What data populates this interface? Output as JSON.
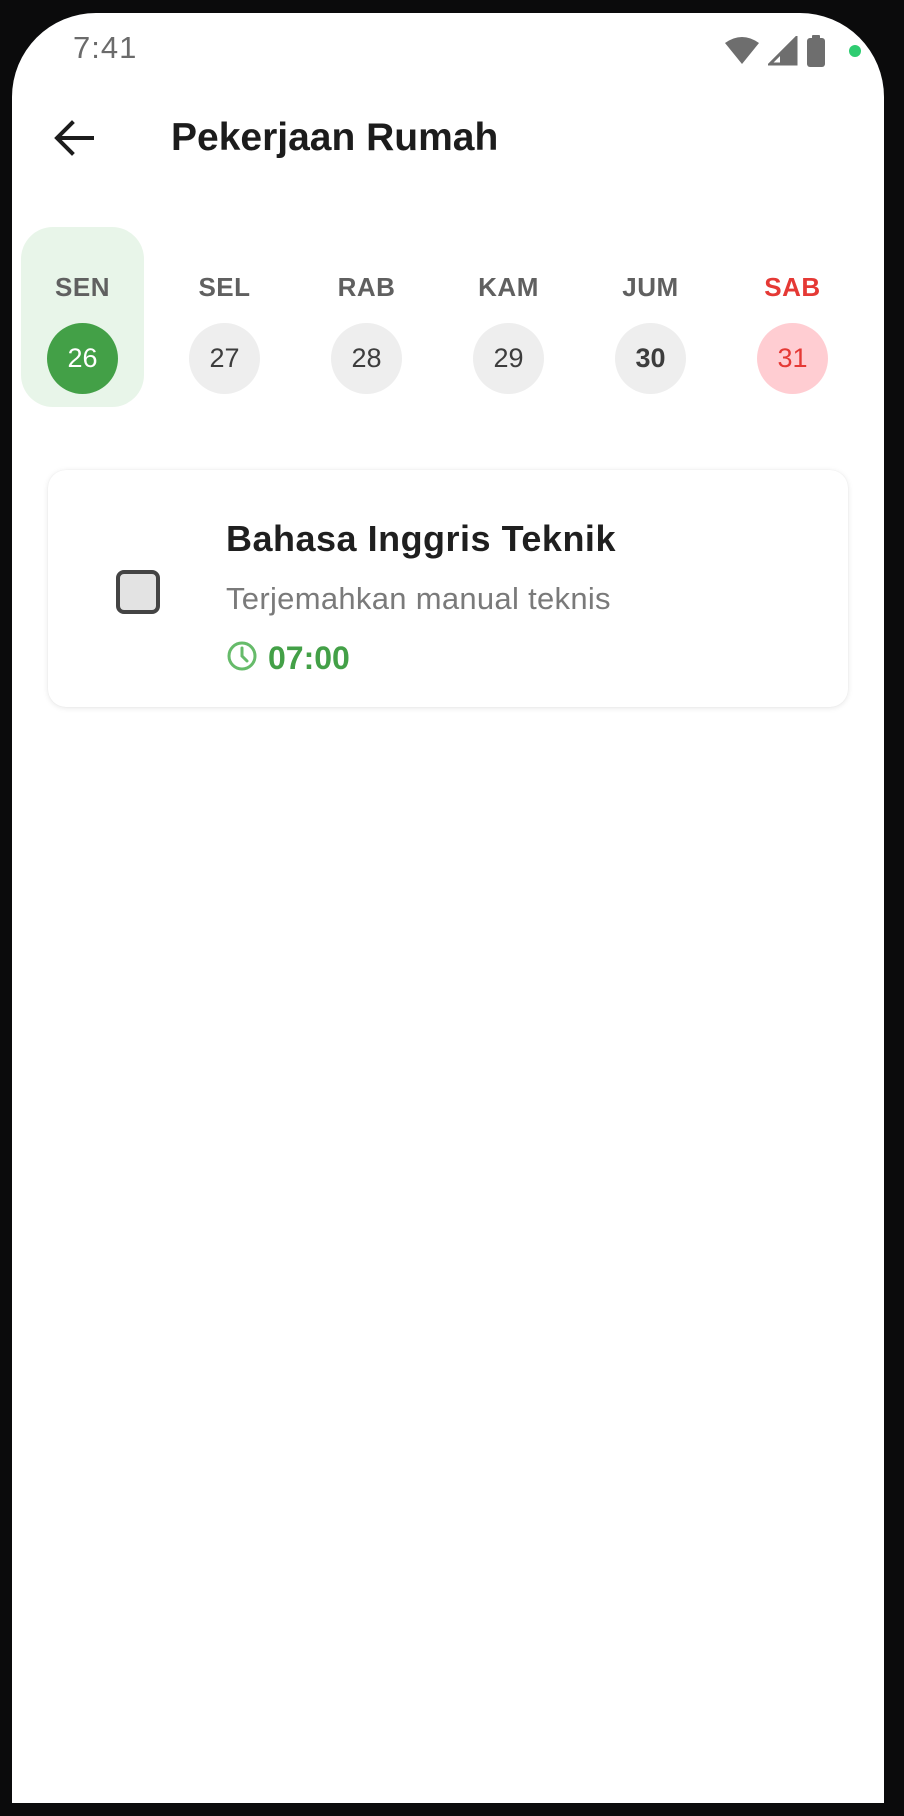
{
  "status_bar": {
    "time": "7:41",
    "icons": [
      "wifi-icon",
      "cellular-signal-icon",
      "battery-icon",
      "privacy-dot-icon"
    ],
    "privacy_dot_color": "#2ecc71"
  },
  "app_bar": {
    "back_icon": "arrow-left-icon",
    "title": "Pekerjaan Rumah"
  },
  "days": [
    {
      "label": "SEN",
      "date": "26",
      "state": "selected"
    },
    {
      "label": "SEL",
      "date": "27",
      "state": "normal"
    },
    {
      "label": "RAB",
      "date": "28",
      "state": "normal"
    },
    {
      "label": "KAM",
      "date": "29",
      "state": "normal"
    },
    {
      "label": "JUM",
      "date": "30",
      "state": "today"
    },
    {
      "label": "SAB",
      "date": "31",
      "state": "weekend"
    }
  ],
  "tasks": [
    {
      "title": "Bahasa Inggris Teknik",
      "description": "Terjemahkan manual teknis",
      "time": "07:00",
      "time_icon": "clock-icon",
      "checked": false
    }
  ],
  "colors": {
    "accent": "#43a047",
    "accent_light": "#e8f5e9",
    "weekend": "#e53935",
    "weekend_light": "#ffcdd2"
  }
}
